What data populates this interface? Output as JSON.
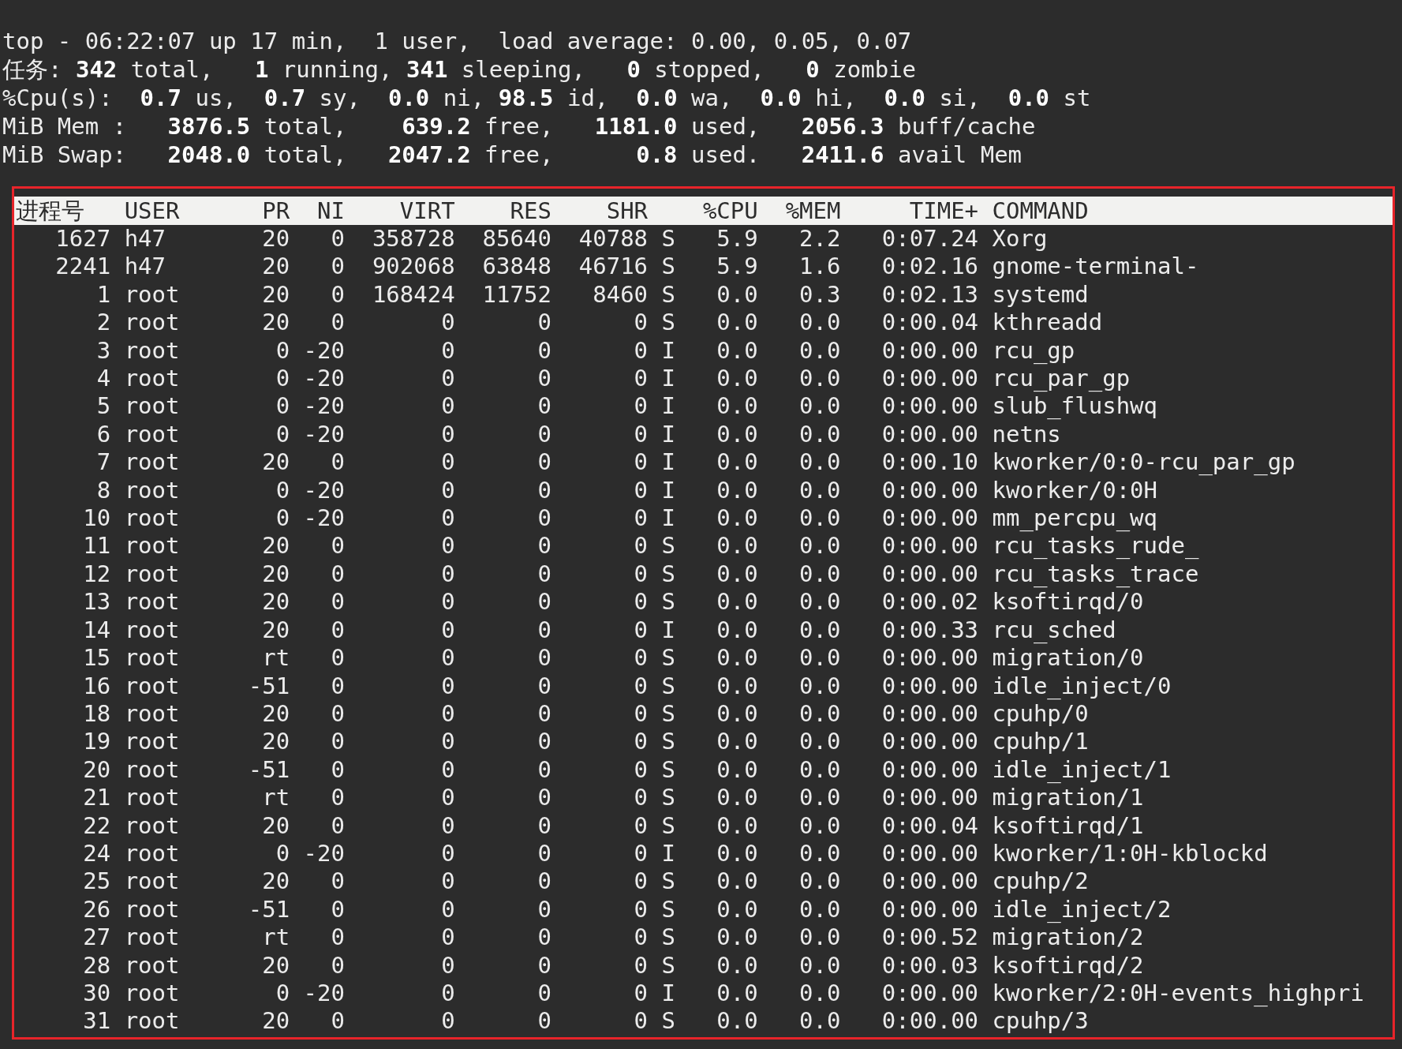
{
  "summary": [
    "top - 06:22:07 up 17 min,  1 user,  load average: 0.00, 0.05, 0.07",
    "任务: **342** total,   **1** running, **341** sleeping,   **0** stopped,   **0** zombie",
    "%Cpu(s):  **0.7** us,  **0.7** sy,  **0.0** ni, **98.5** id,  **0.0** wa,  **0.0** hi,  **0.0** si,  **0.0** st",
    "MiB Mem :   **3876.5** total,    **639.2** free,   **1181.0** used,   **2056.3** buff/cache",
    "MiB Swap:   **2048.0** total,   **2047.2** free,      **0.8** used.   **2411.6** avail Mem"
  ],
  "table": {
    "columns": [
      "进程号",
      "USER",
      "PR",
      "NI",
      "VIRT",
      "RES",
      "SHR",
      "",
      "%CPU",
      "%MEM",
      "TIME+",
      "COMMAND"
    ],
    "rows": [
      [
        "1627",
        "h47",
        "20",
        "0",
        "358728",
        "85640",
        "40788",
        "S",
        "5.9",
        "2.2",
        "0:07.24",
        "Xorg"
      ],
      [
        "2241",
        "h47",
        "20",
        "0",
        "902068",
        "63848",
        "46716",
        "S",
        "5.9",
        "1.6",
        "0:02.16",
        "gnome-terminal-"
      ],
      [
        "1",
        "root",
        "20",
        "0",
        "168424",
        "11752",
        "8460",
        "S",
        "0.0",
        "0.3",
        "0:02.13",
        "systemd"
      ],
      [
        "2",
        "root",
        "20",
        "0",
        "0",
        "0",
        "0",
        "S",
        "0.0",
        "0.0",
        "0:00.04",
        "kthreadd"
      ],
      [
        "3",
        "root",
        "0",
        "-20",
        "0",
        "0",
        "0",
        "I",
        "0.0",
        "0.0",
        "0:00.00",
        "rcu_gp"
      ],
      [
        "4",
        "root",
        "0",
        "-20",
        "0",
        "0",
        "0",
        "I",
        "0.0",
        "0.0",
        "0:00.00",
        "rcu_par_gp"
      ],
      [
        "5",
        "root",
        "0",
        "-20",
        "0",
        "0",
        "0",
        "I",
        "0.0",
        "0.0",
        "0:00.00",
        "slub_flushwq"
      ],
      [
        "6",
        "root",
        "0",
        "-20",
        "0",
        "0",
        "0",
        "I",
        "0.0",
        "0.0",
        "0:00.00",
        "netns"
      ],
      [
        "7",
        "root",
        "20",
        "0",
        "0",
        "0",
        "0",
        "I",
        "0.0",
        "0.0",
        "0:00.10",
        "kworker/0:0-rcu_par_gp"
      ],
      [
        "8",
        "root",
        "0",
        "-20",
        "0",
        "0",
        "0",
        "I",
        "0.0",
        "0.0",
        "0:00.00",
        "kworker/0:0H"
      ],
      [
        "10",
        "root",
        "0",
        "-20",
        "0",
        "0",
        "0",
        "I",
        "0.0",
        "0.0",
        "0:00.00",
        "mm_percpu_wq"
      ],
      [
        "11",
        "root",
        "20",
        "0",
        "0",
        "0",
        "0",
        "S",
        "0.0",
        "0.0",
        "0:00.00",
        "rcu_tasks_rude_"
      ],
      [
        "12",
        "root",
        "20",
        "0",
        "0",
        "0",
        "0",
        "S",
        "0.0",
        "0.0",
        "0:00.00",
        "rcu_tasks_trace"
      ],
      [
        "13",
        "root",
        "20",
        "0",
        "0",
        "0",
        "0",
        "S",
        "0.0",
        "0.0",
        "0:00.02",
        "ksoftirqd/0"
      ],
      [
        "14",
        "root",
        "20",
        "0",
        "0",
        "0",
        "0",
        "I",
        "0.0",
        "0.0",
        "0:00.33",
        "rcu_sched"
      ],
      [
        "15",
        "root",
        "rt",
        "0",
        "0",
        "0",
        "0",
        "S",
        "0.0",
        "0.0",
        "0:00.00",
        "migration/0"
      ],
      [
        "16",
        "root",
        "-51",
        "0",
        "0",
        "0",
        "0",
        "S",
        "0.0",
        "0.0",
        "0:00.00",
        "idle_inject/0"
      ],
      [
        "18",
        "root",
        "20",
        "0",
        "0",
        "0",
        "0",
        "S",
        "0.0",
        "0.0",
        "0:00.00",
        "cpuhp/0"
      ],
      [
        "19",
        "root",
        "20",
        "0",
        "0",
        "0",
        "0",
        "S",
        "0.0",
        "0.0",
        "0:00.00",
        "cpuhp/1"
      ],
      [
        "20",
        "root",
        "-51",
        "0",
        "0",
        "0",
        "0",
        "S",
        "0.0",
        "0.0",
        "0:00.00",
        "idle_inject/1"
      ],
      [
        "21",
        "root",
        "rt",
        "0",
        "0",
        "0",
        "0",
        "S",
        "0.0",
        "0.0",
        "0:00.00",
        "migration/1"
      ],
      [
        "22",
        "root",
        "20",
        "0",
        "0",
        "0",
        "0",
        "S",
        "0.0",
        "0.0",
        "0:00.04",
        "ksoftirqd/1"
      ],
      [
        "24",
        "root",
        "0",
        "-20",
        "0",
        "0",
        "0",
        "I",
        "0.0",
        "0.0",
        "0:00.00",
        "kworker/1:0H-kblockd"
      ],
      [
        "25",
        "root",
        "20",
        "0",
        "0",
        "0",
        "0",
        "S",
        "0.0",
        "0.0",
        "0:00.00",
        "cpuhp/2"
      ],
      [
        "26",
        "root",
        "-51",
        "0",
        "0",
        "0",
        "0",
        "S",
        "0.0",
        "0.0",
        "0:00.00",
        "idle_inject/2"
      ],
      [
        "27",
        "root",
        "rt",
        "0",
        "0",
        "0",
        "0",
        "S",
        "0.0",
        "0.0",
        "0:00.52",
        "migration/2"
      ],
      [
        "28",
        "root",
        "20",
        "0",
        "0",
        "0",
        "0",
        "S",
        "0.0",
        "0.0",
        "0:00.03",
        "ksoftirqd/2"
      ],
      [
        "30",
        "root",
        "0",
        "-20",
        "0",
        "0",
        "0",
        "I",
        "0.0",
        "0.0",
        "0:00.00",
        "kworker/2:0H-events_highpri"
      ],
      [
        "31",
        "root",
        "20",
        "0",
        "0",
        "0",
        "0",
        "S",
        "0.0",
        "0.0",
        "0:00.00",
        "cpuhp/3"
      ]
    ]
  }
}
